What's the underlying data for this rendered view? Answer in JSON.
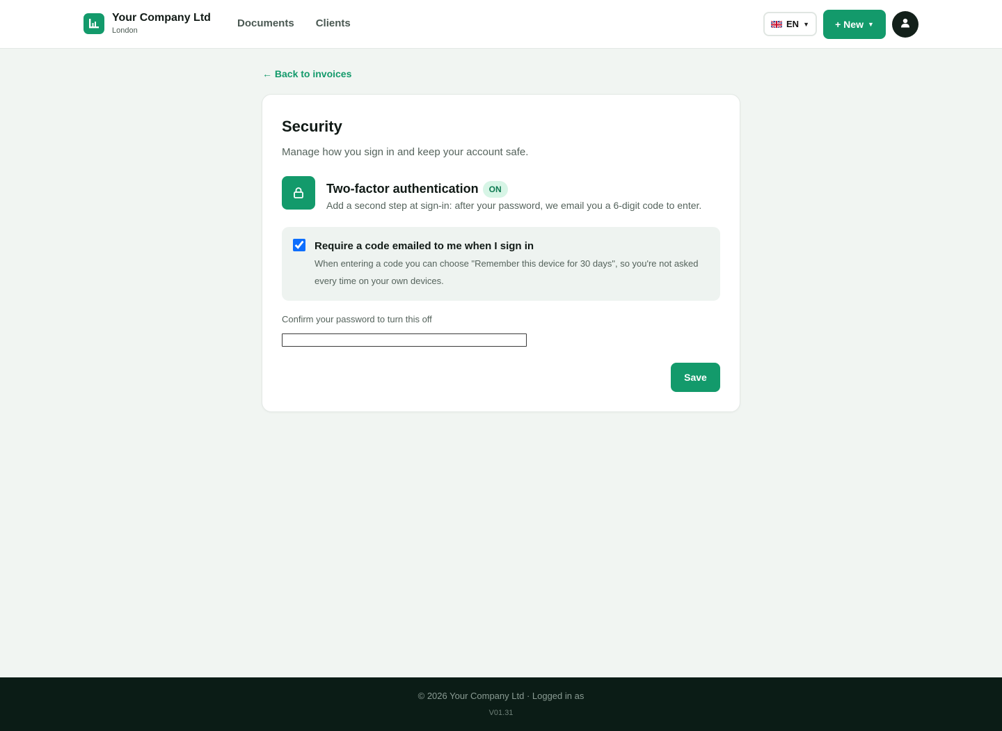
{
  "brand": {
    "name": "Your Company Ltd",
    "location": "London"
  },
  "nav": {
    "documents": "Documents",
    "clients": "Clients"
  },
  "header": {
    "language": "EN",
    "language_icon": "uk-flag-icon",
    "new_button": "+ New",
    "avatar_icon": "user-icon"
  },
  "back_link": "← Back to invoices",
  "security": {
    "title": "Security",
    "description": "Manage how you sign in and keep your account safe.",
    "feature_icon": "lock-icon",
    "feature_title": "Two-factor authentication",
    "status_badge": "ON",
    "feature_description": "Add a second step at sign-in: after your password, we email you a 6-digit code to enter.",
    "option": {
      "checked": true,
      "label": "Require a code emailed to me when I sign in",
      "description": "When entering a code you can choose \"Remember this device for 30 days\", so you're not asked every time on your own devices."
    },
    "password_label": "Confirm your password to turn this off",
    "password_value": "",
    "save_button": "Save"
  },
  "footer": {
    "copyright": "© 2026 Your Company Ltd · Logged in as",
    "version": "V01.31"
  },
  "colors": {
    "accent": "#139a6b",
    "badge_bg": "#d7f5e6",
    "footer_bg": "#0b1c16",
    "page_bg": "#f1f5f2"
  }
}
